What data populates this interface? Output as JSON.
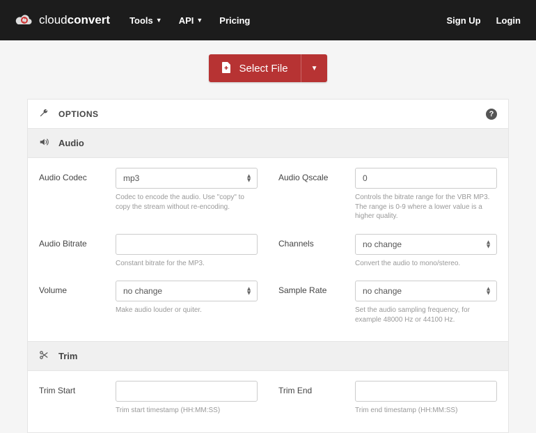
{
  "brand": {
    "thin": "cloud",
    "bold": "convert"
  },
  "nav": {
    "tools": "Tools",
    "api": "API",
    "pricing": "Pricing",
    "signup": "Sign Up",
    "login": "Login"
  },
  "selectFile": {
    "label": "Select File"
  },
  "options": {
    "title": "OPTIONS",
    "audio": {
      "title": "Audio",
      "codec": {
        "label": "Audio Codec",
        "value": "mp3",
        "help": "Codec to encode the audio. Use \"copy\" to copy the stream without re-encoding."
      },
      "qscale": {
        "label": "Audio Qscale",
        "value": "0",
        "help": "Controls the bitrate range for the VBR MP3. The range is 0-9 where a lower value is a higher quality."
      },
      "bitrate": {
        "label": "Audio Bitrate",
        "value": "",
        "help": "Constant bitrate for the MP3."
      },
      "channels": {
        "label": "Channels",
        "value": "no change",
        "help": "Convert the audio to mono/stereo."
      },
      "volume": {
        "label": "Volume",
        "value": "no change",
        "help": "Make audio louder or quiter."
      },
      "sampleRate": {
        "label": "Sample Rate",
        "value": "no change",
        "help": "Set the audio sampling frequency, for example 48000 Hz or 44100 Hz."
      }
    },
    "trim": {
      "title": "Trim",
      "start": {
        "label": "Trim Start",
        "value": "",
        "help": "Trim start timestamp (HH:MM:SS)"
      },
      "end": {
        "label": "Trim End",
        "value": "",
        "help": "Trim end timestamp (HH:MM:SS)"
      }
    }
  }
}
